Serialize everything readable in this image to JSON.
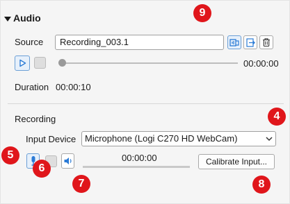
{
  "audio_section": {
    "title": "Audio",
    "source_label": "Source",
    "source_value": "Recording_003.1",
    "playback_time": "00:00:00",
    "duration_label": "Duration",
    "duration_value": "00:00:10",
    "playback_progress": 0
  },
  "recording_section": {
    "title": "Recording",
    "input_device_label": "Input Device",
    "input_device_value": "Microphone (Logi C270 HD WebCam)",
    "level_time": "00:00:00",
    "level_progress": 0,
    "calibrate_label": "Calibrate Input..."
  },
  "callouts": [
    "9",
    "4",
    "5",
    "6",
    "7",
    "8"
  ],
  "colors": {
    "accent": "#2b7bd6",
    "callout": "#e0161b"
  }
}
